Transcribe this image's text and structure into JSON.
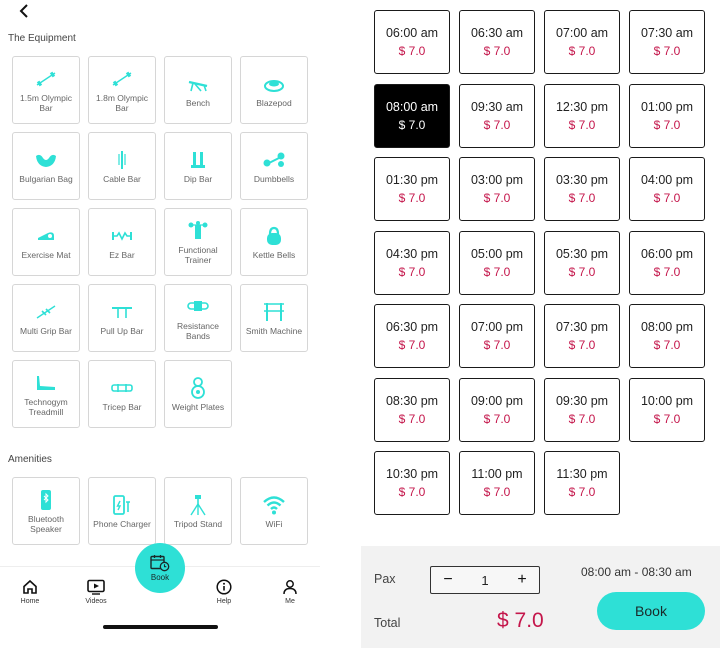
{
  "colors": {
    "accent": "#2ee0d6",
    "price": "#c4164b",
    "selected_bg": "#000000"
  },
  "equipment": {
    "title": "The Equipment",
    "items": [
      {
        "label": "1.5m Olympic Bar",
        "icon": "barbell-icon"
      },
      {
        "label": "1.8m Olympic Bar",
        "icon": "barbell-icon"
      },
      {
        "label": "Bench",
        "icon": "bench-icon"
      },
      {
        "label": "Blazepod",
        "icon": "blazepod-icon"
      },
      {
        "label": "Bulgarian Bag",
        "icon": "bulgarian-bag-icon"
      },
      {
        "label": "Cable Bar",
        "icon": "cable-bar-icon"
      },
      {
        "label": "Dip Bar",
        "icon": "dip-bar-icon"
      },
      {
        "label": "Dumbbells",
        "icon": "dumbbells-icon"
      },
      {
        "label": "Exercise Mat",
        "icon": "exercise-mat-icon"
      },
      {
        "label": "Ez Bar",
        "icon": "ez-bar-icon"
      },
      {
        "label": "Functional Trainer",
        "icon": "functional-trainer-icon"
      },
      {
        "label": "Kettle Bells",
        "icon": "kettlebell-icon"
      },
      {
        "label": "Multi Grip Bar",
        "icon": "multi-grip-bar-icon"
      },
      {
        "label": "Pull Up Bar",
        "icon": "pull-up-bar-icon"
      },
      {
        "label": "Resistance Bands",
        "icon": "resistance-bands-icon"
      },
      {
        "label": "Smith Machine",
        "icon": "smith-machine-icon"
      },
      {
        "label": "Technogym Treadmill",
        "icon": "treadmill-icon"
      },
      {
        "label": "Tricep Bar",
        "icon": "tricep-bar-icon"
      },
      {
        "label": "Weight Plates",
        "icon": "weight-plates-icon"
      }
    ]
  },
  "amenities": {
    "title": "Amenities",
    "items": [
      {
        "label": "Bluetooth Speaker",
        "icon": "bluetooth-speaker-icon"
      },
      {
        "label": "Phone Charger",
        "icon": "phone-charger-icon"
      },
      {
        "label": "Tripod Stand",
        "icon": "tripod-icon"
      },
      {
        "label": "WiFi",
        "icon": "wifi-icon"
      }
    ]
  },
  "nav": {
    "home": "Home",
    "videos": "Videos",
    "book": "Book",
    "help": "Help",
    "me": "Me"
  },
  "slots": [
    {
      "time": "06:00 am",
      "price": "$ 7.0",
      "selected": false
    },
    {
      "time": "06:30 am",
      "price": "$ 7.0",
      "selected": false
    },
    {
      "time": "07:00 am",
      "price": "$ 7.0",
      "selected": false
    },
    {
      "time": "07:30 am",
      "price": "$ 7.0",
      "selected": false
    },
    {
      "time": "08:00 am",
      "price": "$ 7.0",
      "selected": true
    },
    {
      "time": "09:30 am",
      "price": "$ 7.0",
      "selected": false
    },
    {
      "time": "12:30 pm",
      "price": "$ 7.0",
      "selected": false
    },
    {
      "time": "01:00 pm",
      "price": "$ 7.0",
      "selected": false
    },
    {
      "time": "01:30 pm",
      "price": "$ 7.0",
      "selected": false
    },
    {
      "time": "03:00 pm",
      "price": "$ 7.0",
      "selected": false
    },
    {
      "time": "03:30 pm",
      "price": "$ 7.0",
      "selected": false
    },
    {
      "time": "04:00 pm",
      "price": "$ 7.0",
      "selected": false
    },
    {
      "time": "04:30 pm",
      "price": "$ 7.0",
      "selected": false
    },
    {
      "time": "05:00 pm",
      "price": "$ 7.0",
      "selected": false
    },
    {
      "time": "05:30 pm",
      "price": "$ 7.0",
      "selected": false
    },
    {
      "time": "06:00 pm",
      "price": "$ 7.0",
      "selected": false
    },
    {
      "time": "06:30 pm",
      "price": "$ 7.0",
      "selected": false
    },
    {
      "time": "07:00 pm",
      "price": "$ 7.0",
      "selected": false
    },
    {
      "time": "07:30 pm",
      "price": "$ 7.0",
      "selected": false
    },
    {
      "time": "08:00 pm",
      "price": "$ 7.0",
      "selected": false
    },
    {
      "time": "08:30 pm",
      "price": "$ 7.0",
      "selected": false
    },
    {
      "time": "09:00 pm",
      "price": "$ 7.0",
      "selected": false
    },
    {
      "time": "09:30 pm",
      "price": "$ 7.0",
      "selected": false
    },
    {
      "time": "10:00 pm",
      "price": "$ 7.0",
      "selected": false
    },
    {
      "time": "10:30 pm",
      "price": "$ 7.0",
      "selected": false
    },
    {
      "time": "11:00 pm",
      "price": "$ 7.0",
      "selected": false
    },
    {
      "time": "11:30 pm",
      "price": "$ 7.0",
      "selected": false
    }
  ],
  "booking": {
    "pax_label": "Pax",
    "pax_value": "1",
    "minus": "−",
    "plus": "+",
    "time_range": "08:00 am - 08:30 am",
    "total_label": "Total",
    "total_value": "$ 7.0",
    "book_label": "Book"
  }
}
